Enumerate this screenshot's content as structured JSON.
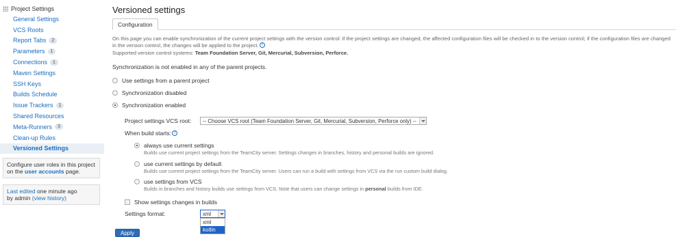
{
  "sidebar": {
    "header": "Project Settings",
    "items": [
      {
        "label": "General Settings",
        "badge": ""
      },
      {
        "label": "VCS Roots",
        "badge": ""
      },
      {
        "label": "Report Tabs",
        "badge": "2"
      },
      {
        "label": "Parameters",
        "badge": "1"
      },
      {
        "label": "Connections",
        "badge": "1"
      },
      {
        "label": "Maven Settings",
        "badge": ""
      },
      {
        "label": "SSH Keys",
        "badge": ""
      },
      {
        "label": "Builds Schedule",
        "badge": ""
      },
      {
        "label": "Issue Trackers",
        "badge": "1"
      },
      {
        "label": "Shared Resources",
        "badge": ""
      },
      {
        "label": "Meta-Runners",
        "badge": "3"
      },
      {
        "label": "Clean-up Rules",
        "badge": ""
      },
      {
        "label": "Versioned Settings",
        "badge": ""
      }
    ],
    "roles_text": "Configure user roles in this project on the",
    "roles_link": "user accounts",
    "roles_suffix": "page.",
    "last_edited_label": "Last edited",
    "last_edited_time": "one minute ago",
    "last_edited_by": "by admin",
    "view_history": "(view history)"
  },
  "main": {
    "title": "Versioned settings",
    "tab": "Configuration",
    "desc_line1": "On this page you can enable synchronization of the current project settings with the version control: if the project settings are changed, the affected configuration files will be checked in to the version control; if the configuration files are changed",
    "desc_line2": "in the version control, the changes will be applied to the project.",
    "supported_label": "Supported version control systems:",
    "supported_systems": "Team Foundation Server, Git, Mercurial, Subversion, Perforce.",
    "not_enabled": "Synchronization is not enabled in any of the parent projects.",
    "radios": [
      {
        "label": "Use settings from a parent project",
        "checked": false
      },
      {
        "label": "Synchronization disabled",
        "checked": false
      },
      {
        "label": "Synchronization enabled",
        "checked": true
      }
    ],
    "vcs_root_label": "Project settings VCS root:",
    "vcs_root_value": "-- Choose VCS root (Team Foundation Server, Git, Mercurial, Subversion, Perforce only) --",
    "when_build_label": "When build starts:",
    "build_options": [
      {
        "label": "always use current settings",
        "desc": "Builds use current project settings from the TeamCity server. Settings changes in branches, history and personal builds are ignored."
      },
      {
        "label": "use current settings by default",
        "desc": "Builds use current project settings from the TeamCity server. Users can run a build with settings from VCS via the run custom build dialog."
      },
      {
        "label": "use settings from VCS",
        "desc_pre": "Builds in branches and history builds use settings from VCS. Note that users can change settings in",
        "desc_bold": "personal",
        "desc_post": "builds from IDE."
      }
    ],
    "show_changes_label": "Show settings changes in builds",
    "format_label": "Settings format:",
    "format_value": "xml",
    "format_options": [
      "xml",
      "kotlin"
    ],
    "apply_label": "Apply"
  }
}
